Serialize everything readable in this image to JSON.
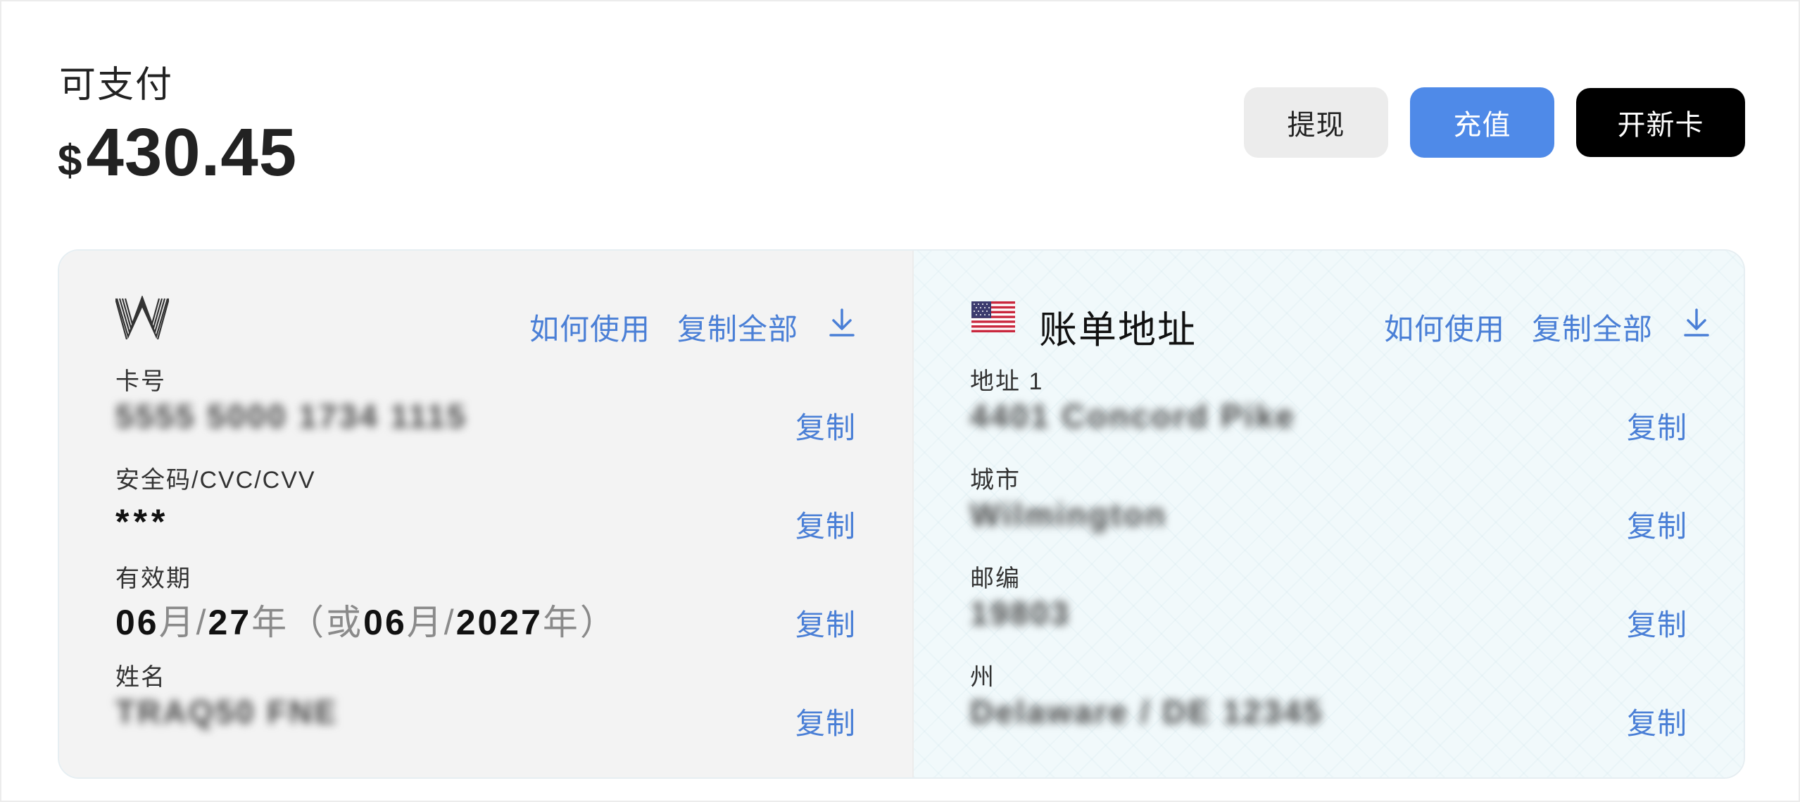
{
  "balance": {
    "label": "可支付",
    "currency_symbol": "$",
    "amount": "430.45"
  },
  "actions": {
    "withdraw": "提现",
    "topup": "充值",
    "new_card": "开新卡"
  },
  "card": {
    "logo_icon": "w-brand-logo-icon",
    "how_to_use": "如何使用",
    "copy_all": "复制全部",
    "download_icon": "download-icon",
    "fields": {
      "number": {
        "label": "卡号",
        "value": "5555 5000 1734 1115",
        "copy": "复制"
      },
      "cvc": {
        "label": "安全码/CVC/CVV",
        "value": "***",
        "copy": "复制"
      },
      "expiry": {
        "label": "有效期",
        "mm": "06",
        "month_char": "月",
        "slash": "/",
        "yy": "27",
        "year_char": "年",
        "paren_open": "（或",
        "mm2": "06",
        "month_char2": "月",
        "slash2": "/",
        "yyyy": "2027",
        "year_char2": "年",
        "paren_close": "）",
        "copy": "复制"
      },
      "name": {
        "label": "姓名",
        "value": "TRAQ50 FNE",
        "copy": "复制"
      }
    }
  },
  "billing": {
    "flag_icon": "us-flag-icon",
    "title": "账单地址",
    "how_to_use": "如何使用",
    "copy_all": "复制全部",
    "download_icon": "download-icon",
    "fields": {
      "address1": {
        "label": "地址 1",
        "value": "4401 Concord Pike",
        "copy": "复制"
      },
      "city": {
        "label": "城市",
        "value": "Wilmington",
        "copy": "复制"
      },
      "zip": {
        "label": "邮编",
        "value": "19803",
        "copy": "复制"
      },
      "state": {
        "label": "州",
        "value": "Delaware / DE 12345",
        "copy": "复制"
      }
    }
  },
  "colors": {
    "accent": "#4f8ae8",
    "link": "#4a7fd6",
    "black_button": "#000000",
    "gray_button": "#ececec"
  }
}
